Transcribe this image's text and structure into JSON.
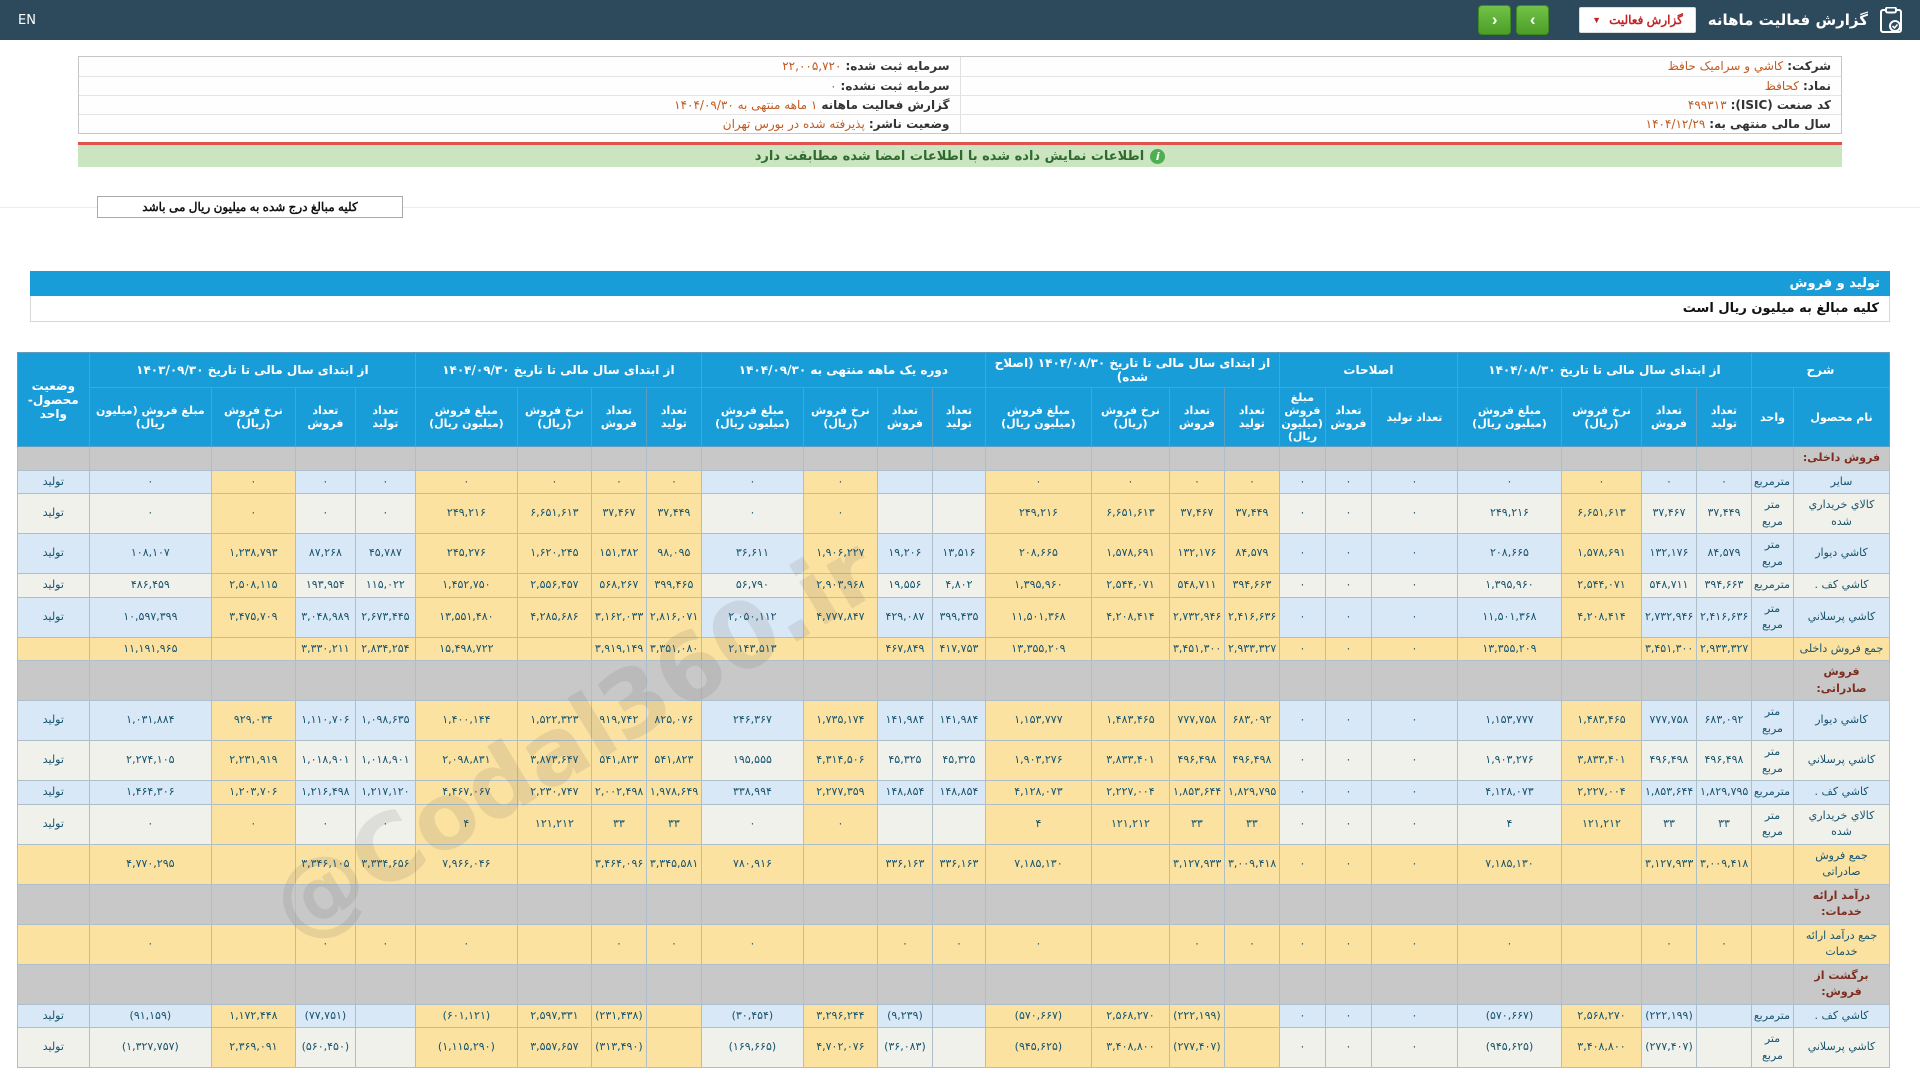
{
  "topbar": {
    "title": "گزارش فعالیت ماهانه",
    "dropdown_label": "گزارش فعالیت",
    "dropdown_chevron": "▼",
    "next_label": "›",
    "prev_label": "‹",
    "lang": "EN"
  },
  "info": {
    "rows": [
      {
        "right": {
          "label": "شرکت:",
          "value": "کاشي و سرامیک حافظ"
        },
        "left": {
          "label": "سرمایه ثبت شده:",
          "value": "۲۲,۰۰۵,۷۲۰"
        }
      },
      {
        "right": {
          "label": "نماد:",
          "value": "کحافظ"
        },
        "left": {
          "label": "سرمایه ثبت نشده:",
          "value": "۰"
        }
      },
      {
        "right": {
          "label": "کد صنعت (ISIC):",
          "value": "۴۹۹۳۱۳"
        },
        "left": {
          "label": "گزارش فعالیت ماهانه",
          "value": "۱ ماهه منتهی به ۱۴۰۴/۰۹/۳۰"
        }
      },
      {
        "right": {
          "label": "سال مالی منتهی به:",
          "value": "۱۴۰۴/۱۲/۲۹"
        },
        "left": {
          "label": "وضعیت ناشر:",
          "value": "پذیرفته شده در بورس تهران"
        }
      }
    ]
  },
  "notice_text": "اطلاعات نمایش داده شده با اطلاعات امضا شده مطابقت دارد",
  "notice_icon": "i",
  "unit_note_button": "کلیه مبالغ درج شده به میلیون ریال می باشد",
  "section_bar": "تولید و فروش",
  "table_note": "کلیه مبالغ به میلیون ریال است",
  "watermark": "@Codal360.ir",
  "table": {
    "desc_group": "شرح",
    "desc_cols": [
      "نام محصول",
      "واحد"
    ],
    "status_col": "وضعیت محصول-واحد",
    "groups": [
      {
        "label": "از ابتدای سال مالی تا تاریخ ۱۴۰۴/۰۸/۳۰",
        "cols": [
          "تعداد تولید",
          "تعداد فروش",
          "نرخ فروش (ریال)",
          "مبلغ فروش (میلیون ریال)"
        ]
      },
      {
        "label": "اصلاحات",
        "cols": [
          "تعداد تولید",
          "تعداد فروش",
          "مبلغ فروش (میلیون ریال)"
        ]
      },
      {
        "label": "از ابتدای سال مالی تا تاریخ ۱۴۰۴/۰۸/۳۰ (اصلاح شده)",
        "cols": [
          "تعداد تولید",
          "تعداد فروش",
          "نرخ فروش (ریال)",
          "مبلغ فروش (میلیون ریال)"
        ]
      },
      {
        "label": "دوره یک ماهه منتهی به ۱۴۰۴/۰۹/۳۰",
        "cols": [
          "تعداد تولید",
          "تعداد فروش",
          "نرخ فروش (ریال)",
          "مبلغ فروش (میلیون ریال)"
        ]
      },
      {
        "label": "از ابتدای سال مالی تا تاریخ ۱۴۰۴/۰۹/۳۰",
        "cols": [
          "تعداد تولید",
          "تعداد فروش",
          "نرخ فروش (ریال)",
          "مبلغ فروش (میلیون ریال)"
        ]
      },
      {
        "label": "از ابتدای سال مالی تا تاریخ ۱۴۰۳/۰۹/۳۰",
        "cols": [
          "تعداد تولید",
          "تعداد فروش",
          "نرخ فروش (ریال)",
          "مبلغ فروش (میلیون ریال)"
        ]
      }
    ],
    "rows": [
      {
        "type": "section",
        "name": "فروش داخلی:"
      },
      {
        "type": "data",
        "shade": "blue",
        "name": "سایر",
        "unit": "مترمربع",
        "cells": [
          "۰",
          "۰",
          "۰",
          "۰",
          "۰",
          "۰",
          "۰",
          "۰",
          "۰",
          "۰",
          "۰",
          "",
          "",
          "۰",
          "۰",
          "۰",
          "۰",
          "۰",
          "۰",
          "۰",
          "۰",
          "۰",
          "۰",
          "تولید"
        ]
      },
      {
        "type": "data",
        "shade": "white",
        "name": "کالاي خریداري شده",
        "unit": "متر مربع",
        "cells": [
          "۳۷,۴۴۹",
          "۳۷,۴۶۷",
          "۶,۶۵۱,۶۱۳",
          "۲۴۹,۲۱۶",
          "۰",
          "۰",
          "۰",
          "۳۷,۴۴۹",
          "۳۷,۴۶۷",
          "۶,۶۵۱,۶۱۳",
          "۲۴۹,۲۱۶",
          "",
          "",
          "۰",
          "۰",
          "۳۷,۴۴۹",
          "۳۷,۴۶۷",
          "۶,۶۵۱,۶۱۳",
          "۲۴۹,۲۱۶",
          "۰",
          "۰",
          "۰",
          "۰",
          "تولید"
        ]
      },
      {
        "type": "data",
        "shade": "blue",
        "name": "کاشي دیوار",
        "unit": "متر مربع",
        "cells": [
          "۸۴,۵۷۹",
          "۱۳۲,۱۷۶",
          "۱,۵۷۸,۶۹۱",
          "۲۰۸,۶۶۵",
          "۰",
          "۰",
          "۰",
          "۸۴,۵۷۹",
          "۱۳۲,۱۷۶",
          "۱,۵۷۸,۶۹۱",
          "۲۰۸,۶۶۵",
          "۱۳,۵۱۶",
          "۱۹,۲۰۶",
          "۱,۹۰۶,۲۲۷",
          "۳۶,۶۱۱",
          "۹۸,۰۹۵",
          "۱۵۱,۳۸۲",
          "۱,۶۲۰,۲۴۵",
          "۲۴۵,۲۷۶",
          "۴۵,۷۸۷",
          "۸۷,۲۶۸",
          "۱,۲۳۸,۷۹۳",
          "۱۰۸,۱۰۷",
          "تولید"
        ]
      },
      {
        "type": "data",
        "shade": "white",
        "name": "کاشي کف .",
        "unit": "مترمربع",
        "cells": [
          "۳۹۴,۶۶۳",
          "۵۴۸,۷۱۱",
          "۲,۵۴۴,۰۷۱",
          "۱,۳۹۵,۹۶۰",
          "۰",
          "۰",
          "۰",
          "۳۹۴,۶۶۳",
          "۵۴۸,۷۱۱",
          "۲,۵۴۴,۰۷۱",
          "۱,۳۹۵,۹۶۰",
          "۴,۸۰۲",
          "۱۹,۵۵۶",
          "۲,۹۰۳,۹۶۸",
          "۵۶,۷۹۰",
          "۳۹۹,۴۶۵",
          "۵۶۸,۲۶۷",
          "۲,۵۵۶,۴۵۷",
          "۱,۴۵۲,۷۵۰",
          "۱۱۵,۰۲۲",
          "۱۹۳,۹۵۴",
          "۲,۵۰۸,۱۱۵",
          "۴۸۶,۴۵۹",
          "تولید"
        ]
      },
      {
        "type": "data",
        "shade": "blue",
        "name": "کاشي پرسلاني",
        "unit": "متر مربع",
        "cells": [
          "۲,۴۱۶,۶۳۶",
          "۲,۷۳۲,۹۴۶",
          "۴,۲۰۸,۴۱۴",
          "۱۱,۵۰۱,۳۶۸",
          "۰",
          "۰",
          "۰",
          "۲,۴۱۶,۶۳۶",
          "۲,۷۳۲,۹۴۶",
          "۴,۲۰۸,۴۱۴",
          "۱۱,۵۰۱,۳۶۸",
          "۳۹۹,۴۳۵",
          "۴۲۹,۰۸۷",
          "۴,۷۷۷,۸۴۷",
          "۲,۰۵۰,۱۱۲",
          "۲,۸۱۶,۰۷۱",
          "۳,۱۶۲,۰۳۳",
          "۴,۲۸۵,۶۸۶",
          "۱۳,۵۵۱,۴۸۰",
          "۲,۶۷۳,۴۴۵",
          "۳,۰۴۸,۹۸۹",
          "۳,۴۷۵,۷۰۹",
          "۱۰,۵۹۷,۳۹۹",
          "تولید"
        ]
      },
      {
        "type": "total",
        "shade": "total",
        "name": "جمع فروش داخلی",
        "unit": "",
        "cells": [
          "۲,۹۳۳,۳۲۷",
          "۳,۴۵۱,۳۰۰",
          "",
          "۱۳,۳۵۵,۲۰۹",
          "۰",
          "۰",
          "۰",
          "۲,۹۳۳,۳۲۷",
          "۳,۴۵۱,۳۰۰",
          "",
          "۱۳,۳۵۵,۲۰۹",
          "۴۱۷,۷۵۳",
          "۴۶۷,۸۴۹",
          "",
          "۲,۱۴۳,۵۱۳",
          "۳,۳۵۱,۰۸۰",
          "۳,۹۱۹,۱۴۹",
          "",
          "۱۵,۴۹۸,۷۲۲",
          "۲,۸۳۴,۲۵۴",
          "۳,۳۳۰,۲۱۱",
          "",
          "۱۱,۱۹۱,۹۶۵",
          ""
        ]
      },
      {
        "type": "section",
        "name": "فروش صادراتی:"
      },
      {
        "type": "data",
        "shade": "blue",
        "name": "کاشي دیوار",
        "unit": "متر مربع",
        "cells": [
          "۶۸۳,۰۹۲",
          "۷۷۷,۷۵۸",
          "۱,۴۸۳,۴۶۵",
          "۱,۱۵۳,۷۷۷",
          "۰",
          "۰",
          "۰",
          "۶۸۳,۰۹۲",
          "۷۷۷,۷۵۸",
          "۱,۴۸۳,۴۶۵",
          "۱,۱۵۳,۷۷۷",
          "۱۴۱,۹۸۴",
          "۱۴۱,۹۸۴",
          "۱,۷۳۵,۱۷۴",
          "۲۴۶,۳۶۷",
          "۸۲۵,۰۷۶",
          "۹۱۹,۷۴۲",
          "۱,۵۲۲,۳۲۳",
          "۱,۴۰۰,۱۴۴",
          "۱,۰۹۸,۶۳۵",
          "۱,۱۱۰,۷۰۶",
          "۹۲۹,۰۳۴",
          "۱,۰۳۱,۸۸۴",
          "تولید"
        ]
      },
      {
        "type": "data",
        "shade": "white",
        "name": "کاشي پرسلاني",
        "unit": "متر مربع",
        "cells": [
          "۴۹۶,۴۹۸",
          "۴۹۶,۴۹۸",
          "۳,۸۳۳,۴۰۱",
          "۱,۹۰۳,۲۷۶",
          "۰",
          "۰",
          "۰",
          "۴۹۶,۴۹۸",
          "۴۹۶,۴۹۸",
          "۳,۸۳۳,۴۰۱",
          "۱,۹۰۳,۲۷۶",
          "۴۵,۳۲۵",
          "۴۵,۳۲۵",
          "۴,۳۱۴,۵۰۶",
          "۱۹۵,۵۵۵",
          "۵۴۱,۸۲۳",
          "۵۴۱,۸۲۳",
          "۳,۸۷۳,۶۴۷",
          "۲,۰۹۸,۸۳۱",
          "۱,۰۱۸,۹۰۱",
          "۱,۰۱۸,۹۰۱",
          "۲,۲۳۱,۹۱۹",
          "۲,۲۷۴,۱۰۵",
          "تولید"
        ]
      },
      {
        "type": "data",
        "shade": "blue",
        "name": "کاشي کف .",
        "unit": "مترمربع",
        "cells": [
          "۱,۸۲۹,۷۹۵",
          "۱,۸۵۳,۶۴۴",
          "۲,۲۲۷,۰۰۴",
          "۴,۱۲۸,۰۷۳",
          "۰",
          "۰",
          "۰",
          "۱,۸۲۹,۷۹۵",
          "۱,۸۵۳,۶۴۴",
          "۲,۲۲۷,۰۰۴",
          "۴,۱۲۸,۰۷۳",
          "۱۴۸,۸۵۴",
          "۱۴۸,۸۵۴",
          "۲,۲۷۷,۳۵۹",
          "۳۳۸,۹۹۴",
          "۱,۹۷۸,۶۴۹",
          "۲,۰۰۲,۴۹۸",
          "۲,۲۳۰,۷۴۷",
          "۴,۴۶۷,۰۶۷",
          "۱,۲۱۷,۱۲۰",
          "۱,۲۱۶,۴۹۸",
          "۱,۲۰۳,۷۰۶",
          "۱,۴۶۴,۳۰۶",
          "تولید"
        ]
      },
      {
        "type": "data",
        "shade": "white",
        "name": "کالاي خریداري شده",
        "unit": "متر مربع",
        "cells": [
          "۳۳",
          "۳۳",
          "۱۲۱,۲۱۲",
          "۴",
          "۰",
          "۰",
          "۰",
          "۳۳",
          "۳۳",
          "۱۲۱,۲۱۲",
          "۴",
          "",
          "",
          "۰",
          "۰",
          "۳۳",
          "۳۳",
          "۱۲۱,۲۱۲",
          "۴",
          "۰",
          "۰",
          "۰",
          "۰",
          "تولید"
        ]
      },
      {
        "type": "total",
        "shade": "total",
        "name": "جمع فروش صادراتی",
        "unit": "",
        "cells": [
          "۳,۰۰۹,۴۱۸",
          "۳,۱۲۷,۹۳۳",
          "",
          "۷,۱۸۵,۱۳۰",
          "۰",
          "۰",
          "۰",
          "۳,۰۰۹,۴۱۸",
          "۳,۱۲۷,۹۳۳",
          "",
          "۷,۱۸۵,۱۳۰",
          "۳۳۶,۱۶۳",
          "۳۳۶,۱۶۳",
          "",
          "۷۸۰,۹۱۶",
          "۳,۳۴۵,۵۸۱",
          "۳,۴۶۴,۰۹۶",
          "",
          "۷,۹۶۶,۰۴۶",
          "۳,۳۳۴,۶۵۶",
          "۳,۳۴۶,۱۰۵",
          "",
          "۴,۷۷۰,۲۹۵",
          ""
        ]
      },
      {
        "type": "section",
        "name": "درآمد ارائه خدمات:"
      },
      {
        "type": "total",
        "shade": "total",
        "name": "جمع درآمد ارائه خدمات",
        "unit": "",
        "cells": [
          "۰",
          "۰",
          "",
          "۰",
          "۰",
          "۰",
          "۰",
          "۰",
          "۰",
          "",
          "۰",
          "۰",
          "۰",
          "",
          "۰",
          "۰",
          "۰",
          "",
          "۰",
          "۰",
          "۰",
          "",
          "۰",
          ""
        ]
      },
      {
        "type": "section",
        "name": "برگشت از فروش:"
      },
      {
        "type": "data",
        "shade": "blue",
        "name": "کاشي کف .",
        "unit": "مترمربع",
        "cells": [
          "",
          "(۲۲۲,۱۹۹)",
          "۲,۵۶۸,۲۷۰",
          "(۵۷۰,۶۶۷)",
          "۰",
          "۰",
          "۰",
          "",
          "(۲۲۲,۱۹۹)",
          "۲,۵۶۸,۲۷۰",
          "(۵۷۰,۶۶۷)",
          "",
          "(۹,۲۳۹)",
          "۳,۲۹۶,۲۴۴",
          "(۳۰,۴۵۴)",
          "",
          "(۲۳۱,۴۳۸)",
          "۲,۵۹۷,۳۳۱",
          "(۶۰۱,۱۲۱)",
          "",
          "(۷۷,۷۵۱)",
          "۱,۱۷۲,۴۴۸",
          "(۹۱,۱۵۹)",
          "تولید"
        ]
      },
      {
        "type": "data",
        "shade": "white",
        "name": "کاشي پرسلاني",
        "unit": "متر مربع",
        "cells": [
          "",
          "(۲۷۷,۴۰۷)",
          "۳,۴۰۸,۸۰۰",
          "(۹۴۵,۶۲۵)",
          "۰",
          "۰",
          "۰",
          "",
          "(۲۷۷,۴۰۷)",
          "۳,۴۰۸,۸۰۰",
          "(۹۴۵,۶۲۵)",
          "",
          "(۳۶,۰۸۳)",
          "۴,۷۰۲,۰۷۶",
          "(۱۶۹,۶۶۵)",
          "",
          "(۳۱۳,۴۹۰)",
          "۳,۵۵۷,۶۵۷",
          "(۱,۱۱۵,۲۹۰)",
          "",
          "(۵۶۰,۴۵۰)",
          "۲,۳۶۹,۰۹۱",
          "(۱,۳۲۷,۷۵۷)",
          "تولید"
        ]
      }
    ]
  }
}
